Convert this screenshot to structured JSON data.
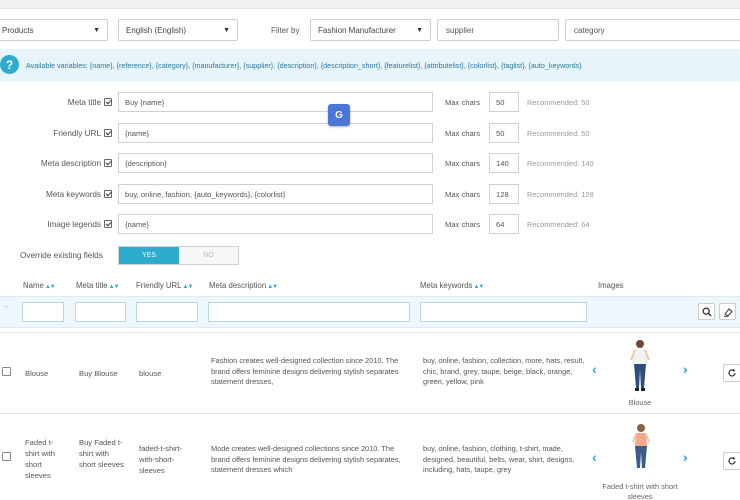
{
  "filters": {
    "entity": "Products",
    "language": "English (English)",
    "filter_by_label": "Filter by",
    "manufacturer": "Fashion Manufacturer",
    "supplier": "supplier",
    "category": "category"
  },
  "banner": {
    "help_glyph": "?",
    "text": "Available variables: {name}, {reference}, {category}, {manufacturer}, {supplier}, {description}, {description_short}, {featurelist}, {attributelist}, {colorlist}, {taglist}, {auto_keywords}"
  },
  "meta_fields": [
    {
      "label": "Meta title",
      "value": "Buy {name}",
      "max_label": "Max chars",
      "max": "50",
      "recommended": "Recommended: 50"
    },
    {
      "label": "Friendly URL",
      "value": "{name}",
      "max_label": "Max chars",
      "max": "50",
      "recommended": "Recommended: 50"
    },
    {
      "label": "Meta description",
      "value": "{description}",
      "max_label": "Max chars",
      "max": "140",
      "recommended": "Recommended: 140"
    },
    {
      "label": "Meta keywords",
      "value": "buy, online, fashion,  {auto_keywords},  {colorlist}",
      "max_label": "Max chars",
      "max": "128",
      "recommended": "Recommended: 128"
    },
    {
      "label": "Image legends",
      "value": "{name}",
      "max_label": "Max chars",
      "max": "64",
      "recommended": "Recommended: 64"
    }
  ],
  "override": {
    "label": "Override existing fields",
    "yes": "YES",
    "no": "NO"
  },
  "table": {
    "headers": {
      "name": "Name",
      "meta_title": "Meta title",
      "friendly_url": "Friendly URL",
      "meta_description": "Meta description",
      "meta_keywords": "Meta keywords",
      "images": "Images"
    },
    "sort_glyph": "▲▼",
    "filter_dash": "--",
    "rows": [
      {
        "name": "Blouse",
        "meta_title": "Buy Blouse",
        "friendly_url": "blouse",
        "meta_description": "Fashion creates well-designed collection since 2010. The brand offers feminine designs delivering stylish separates statement dresses,",
        "meta_keywords": "buy, online, fashion, collection, more, hats, result, chic, brand, grey, taupe, beige, black, orange, green, yellow, pink",
        "image_caption": "Blouse"
      },
      {
        "name": "Faded t-shirt with short sleeves",
        "meta_title": "Buy Faded t-shirt with short sleeves",
        "friendly_url": "faded-t-shirt-with-short-sleeves",
        "meta_description": "Mode creates well-designed collections since 2010. The brand offers feminine designs delivering stylish separates, statement dresses which",
        "meta_keywords": "buy, online, fashion, clothing, t-shirt, made, designed, beautiful, belts, wear, shirt, designs, including, hats, taupe, grey",
        "image_caption": "Faded t-shirt with short sleeves"
      }
    ]
  },
  "colors": {
    "accent": "#2eacce",
    "banner_bg": "#e7f4f9",
    "translate": "#4a76d8"
  }
}
